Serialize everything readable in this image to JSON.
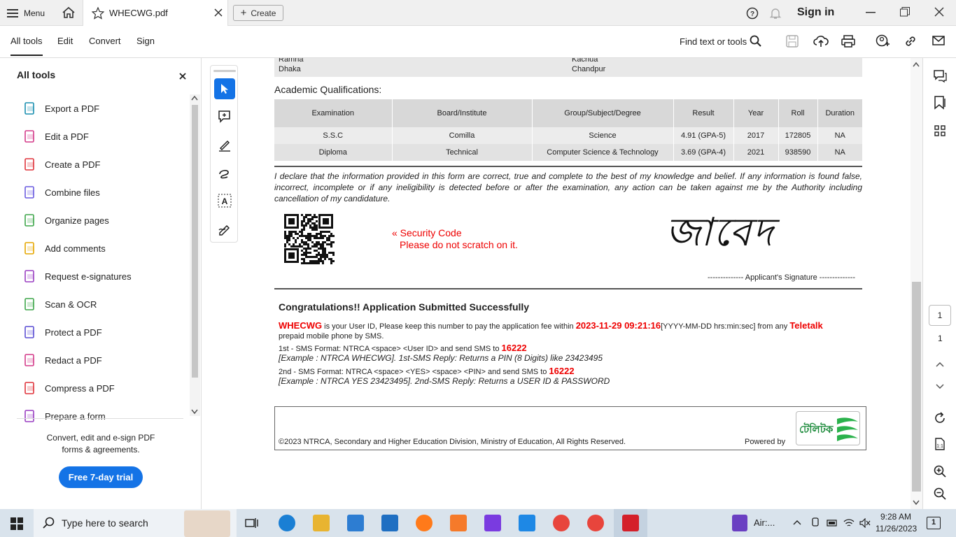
{
  "titlebar": {
    "menu_label": "Menu",
    "tab_title": "WHECWG.pdf",
    "create_label": "Create",
    "signin_label": "Sign in"
  },
  "toolbar": {
    "tabs": [
      "All tools",
      "Edit",
      "Convert",
      "Sign"
    ],
    "find_label": "Find text or tools"
  },
  "sidebar": {
    "title": "All tools",
    "items": [
      {
        "label": "Export a PDF",
        "color": "#1a8fb0"
      },
      {
        "label": "Edit a PDF",
        "color": "#d43b8a"
      },
      {
        "label": "Create a PDF",
        "color": "#e0343c"
      },
      {
        "label": "Combine files",
        "color": "#6a5be0"
      },
      {
        "label": "Organize pages",
        "color": "#3ea64a"
      },
      {
        "label": "Add comments",
        "color": "#e6a700"
      },
      {
        "label": "Request e-signatures",
        "color": "#9a3fc2"
      },
      {
        "label": "Scan & OCR",
        "color": "#3ea64a"
      },
      {
        "label": "Protect a PDF",
        "color": "#5b4fd4"
      },
      {
        "label": "Redact a PDF",
        "color": "#d43b8a"
      },
      {
        "label": "Compress a PDF",
        "color": "#e0343c"
      },
      {
        "label": "Prepare a form",
        "color": "#9a3fc2"
      }
    ],
    "promo_line1": "Convert, edit and e-sign PDF",
    "promo_line2": "forms & agreements.",
    "trial_label": "Free 7-day trial"
  },
  "doc": {
    "address_left": [
      "Ramna",
      "Dhaka"
    ],
    "address_right": [
      "Kachua",
      "Chandpur"
    ],
    "acad_heading": "Academic Qualifications:",
    "table": {
      "headers": [
        "Examination",
        "Board/Institute",
        "Group/Subject/Degree",
        "Result",
        "Year",
        "Roll",
        "Duration"
      ],
      "rows": [
        [
          "S.S.C",
          "Comilla",
          "Science",
          "4.91 (GPA-5)",
          "2017",
          "172805",
          "NA"
        ],
        [
          "Diploma",
          "Technical",
          "Computer Science & Technology",
          "3.69 (GPA-4)",
          "2021",
          "938590",
          "NA"
        ]
      ]
    },
    "declaration": "I declare that the information provided in this form are correct, true and complete to the best of my knowledge and belief. If any information is found false, incorrect, incomplete or if any ineligibility is detected before or after the examination, any action can be taken against me by the Authority including cancellation of my candidature.",
    "security_line1": "« Security Code",
    "security_line2": "Please do not scratch on it.",
    "signature_text": "জাবেদ",
    "signature_label": "-------------- Applicant's Signature --------------",
    "congrats": "Congratulations!! Application Submitted Successfully",
    "user_id": "WHECWG",
    "msg1": " is your User ID, Please keep this number to pay the application fee within ",
    "deadline": "2023-11-29 09:21:16",
    "msg2": "[YYYY-MM-DD hrs:min:sec] from any ",
    "teletalk": "Teletalk",
    "msg3": "prepaid mobile phone by SMS.",
    "sms1": "1st - SMS Format: NTRCA <space> <User ID> and send SMS to ",
    "sms_number": "16222",
    "example1": "[Example : NTRCA WHECWG]. 1st-SMS Reply: Returns a PIN (8 Digits) like 23423495",
    "sms2": "2nd - SMS Format: NTRCA <space> <YES> <space> <PIN> and send SMS to ",
    "example2": "[Example : NTRCA YES 23423495]. 2nd-SMS Reply: Returns a USER ID & PASSWORD",
    "footer": "©2023 NTRCA, Secondary and Higher Education Division, Ministry of Education, All Rights Reserved.",
    "powered": "Powered by",
    "logo_text": "টেলিটক"
  },
  "rightrail": {
    "page_input": "1",
    "page_total": "1"
  },
  "taskbar": {
    "search_placeholder": "Type here to search",
    "weather": "Air:...",
    "time": "9:28 AM",
    "date": "11/26/2023",
    "notif_count": "1"
  }
}
